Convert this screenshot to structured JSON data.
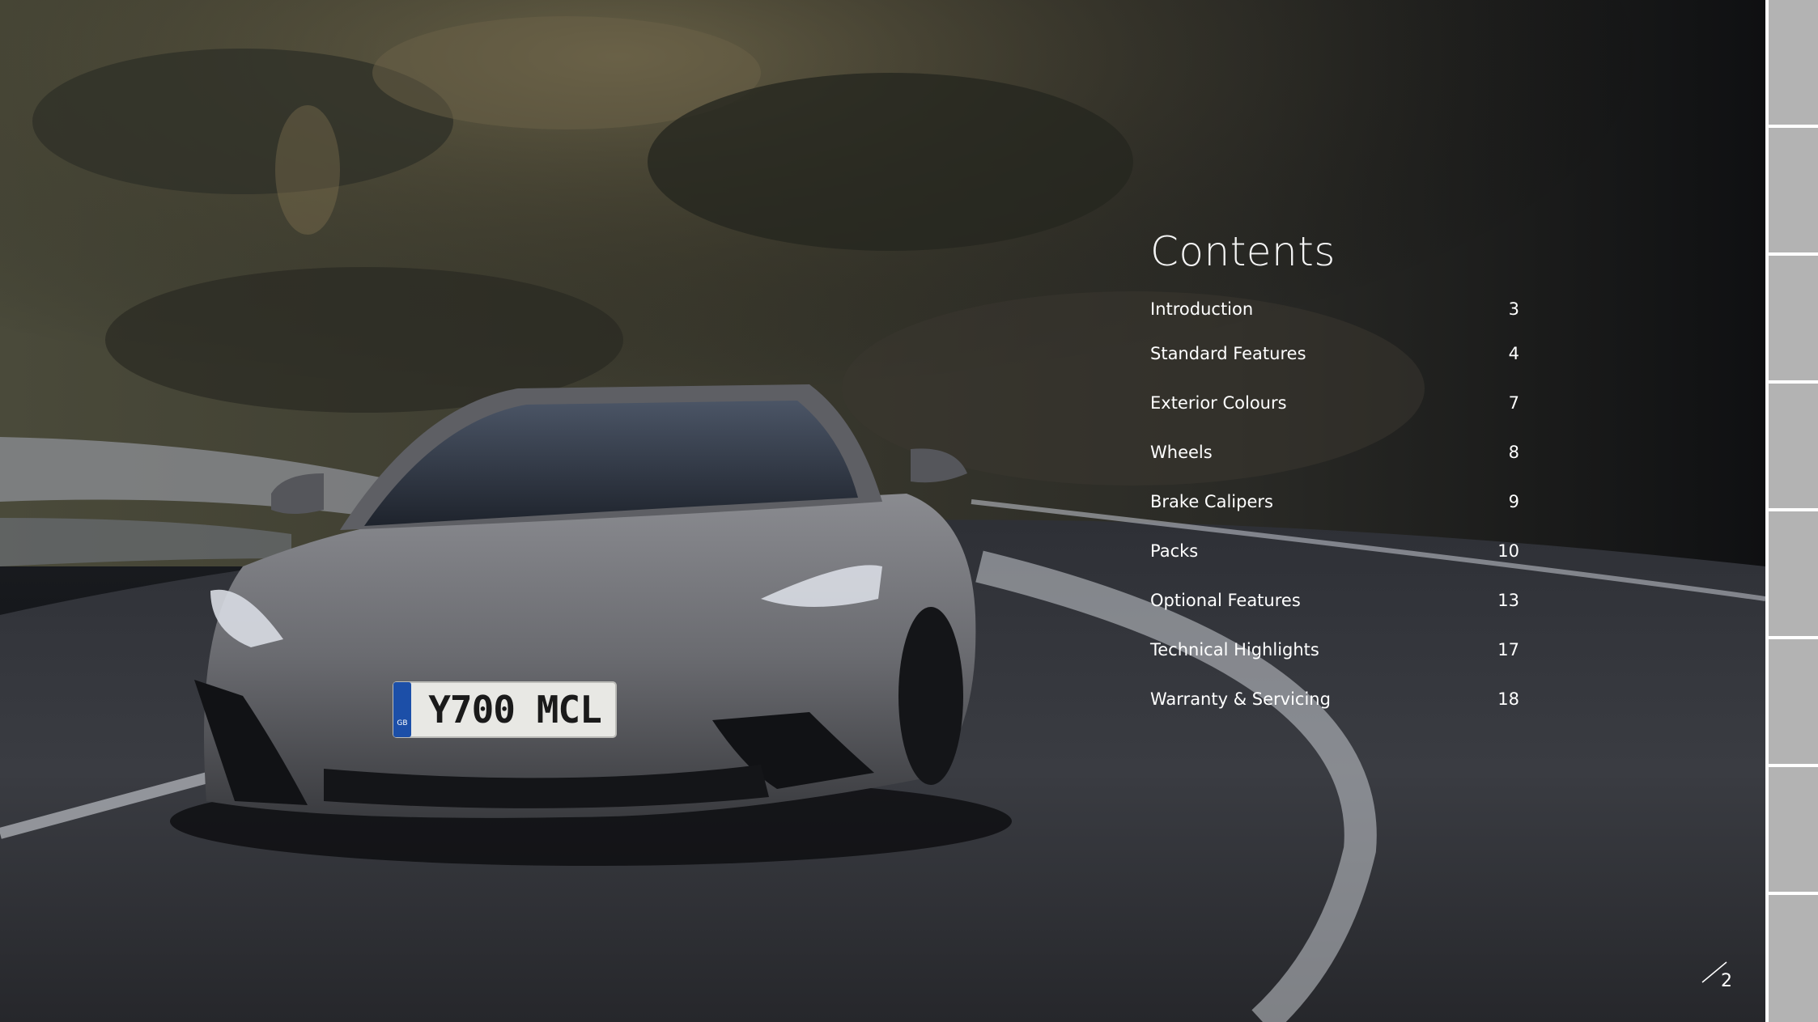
{
  "contents": {
    "title": "Contents",
    "items": [
      {
        "label": "Introduction",
        "page": "3"
      },
      {
        "label": "Standard Features",
        "page": "4"
      },
      {
        "label": "Exterior Colours",
        "page": "7"
      },
      {
        "label": "Wheels",
        "page": "8"
      },
      {
        "label": "Brake Calipers",
        "page": "9"
      },
      {
        "label": "Packs",
        "page": "10"
      },
      {
        "label": "Optional Features",
        "page": "13"
      },
      {
        "label": "Technical Highlights",
        "page": "17"
      },
      {
        "label": "Warranty & Servicing",
        "page": "18"
      }
    ]
  },
  "hero": {
    "license_plate": "Y700 MCL",
    "plate_country": "GB"
  },
  "page_number": "2",
  "colors": {
    "tab_gray": "#b3b3b3",
    "car_body": "#6c6d72",
    "text": "#ffffff"
  }
}
